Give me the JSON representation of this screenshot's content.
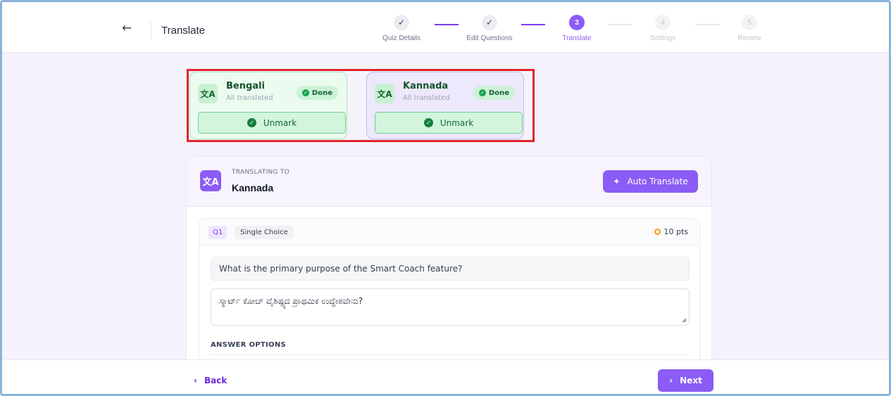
{
  "header": {
    "back_icon": "arrow-left-icon",
    "title": "Translate"
  },
  "steps": [
    {
      "marker": "✓",
      "label": "Quiz Details",
      "state": "done"
    },
    {
      "marker": "✓",
      "label": "Edit Questions",
      "state": "done"
    },
    {
      "marker": "3",
      "label": "Translate",
      "state": "active"
    },
    {
      "marker": "4",
      "label": "Settings",
      "state": "pending"
    },
    {
      "marker": "5",
      "label": "Review",
      "state": "pending"
    }
  ],
  "languages": [
    {
      "name": "Bengali",
      "status_text": "All translated",
      "badge": "Done",
      "button": "Unmark"
    },
    {
      "name": "Kannada",
      "status_text": "All translated",
      "badge": "Done",
      "button": "Unmark"
    }
  ],
  "panel": {
    "translating_label": "TRANSLATING TO",
    "target_language": "Kannada",
    "auto_translate_label": "Auto Translate"
  },
  "question": {
    "number": "Q1",
    "type": "Single Choice",
    "points": "10 pts",
    "source_text": "What is the primary purpose of the Smart Coach feature?",
    "translated_text": "ಸ್ಮಾರ್ಟ್ ಕೋಚ್ ವೈಶಿಷ್ಟ್ಯದ ಪ್ರಾಥಮಿಕ ಉದ್ದೇಶವೇನು?",
    "answer_options_label": "ANSWER OPTIONS"
  },
  "footer": {
    "back_label": "Back",
    "next_label": "Next"
  },
  "colors": {
    "accent": "#8b5cf6",
    "success": "#16a34a",
    "highlight": "#e0242b"
  }
}
